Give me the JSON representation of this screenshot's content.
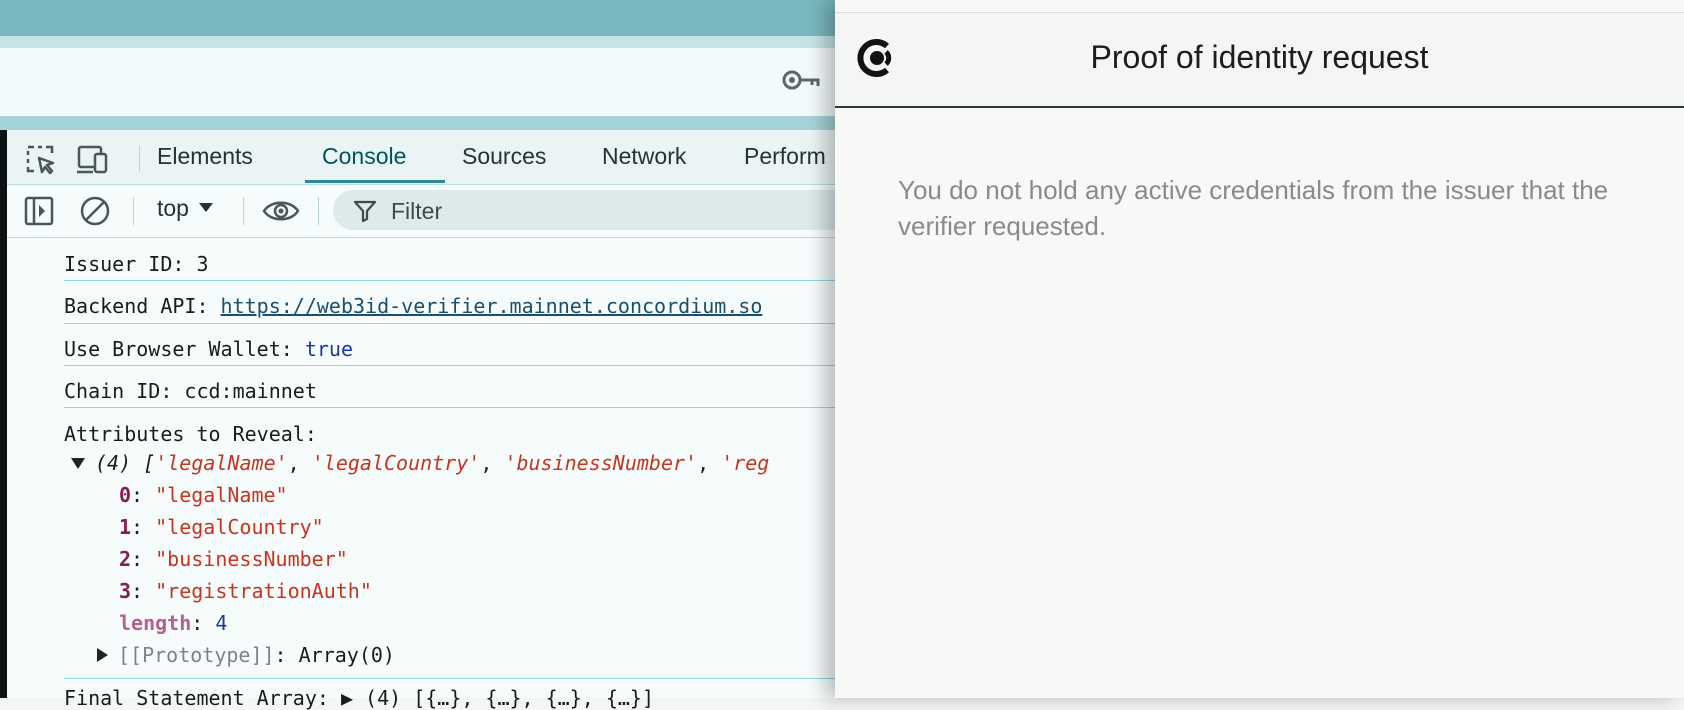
{
  "devtools": {
    "tabs": [
      {
        "label": "Elements"
      },
      {
        "label": "Console"
      },
      {
        "label": "Sources"
      },
      {
        "label": "Network"
      },
      {
        "label": "Perform"
      }
    ],
    "active_tab": "Console",
    "context": "top",
    "filter_placeholder": "Filter"
  },
  "console": {
    "issuer": {
      "label": "Issuer ID:",
      "value": "3"
    },
    "backend": {
      "label": "Backend API:",
      "value": "https://web3id-verifier.mainnet.concordium.so"
    },
    "wallet": {
      "label": "Use Browser Wallet:",
      "value": "true"
    },
    "chain": {
      "label": "Chain ID:",
      "value": "ccd:mainnet"
    },
    "attributes": {
      "label": "Attributes to Reveal:",
      "summary_count": "(4)",
      "summary_items": [
        "'legalName'",
        "'legalCountry'",
        "'businessNumber'",
        "'reg"
      ],
      "items": [
        {
          "index": "0",
          "value": "\"legalName\""
        },
        {
          "index": "1",
          "value": "\"legalCountry\""
        },
        {
          "index": "2",
          "value": "\"businessNumber\""
        },
        {
          "index": "3",
          "value": "\"registrationAuth\""
        }
      ],
      "length_key": "length",
      "length_value": "4",
      "prototype_key": "[[Prototype]]",
      "prototype_value": "Array(0)"
    },
    "cut_line": "Final Statement Array: ▶ (4) [{…}, {…}, {…}, {…}]"
  },
  "popup": {
    "title": "Proof of identity request",
    "message": "You do not hold any active credentials from the issuer that the verifier requested."
  },
  "icons": [
    "key-icon",
    "inspect-element-icon",
    "device-toolbar-icon",
    "sidebar-toggle-icon",
    "clear-console-icon",
    "eye-icon",
    "filter-icon",
    "concordium-logo"
  ]
}
